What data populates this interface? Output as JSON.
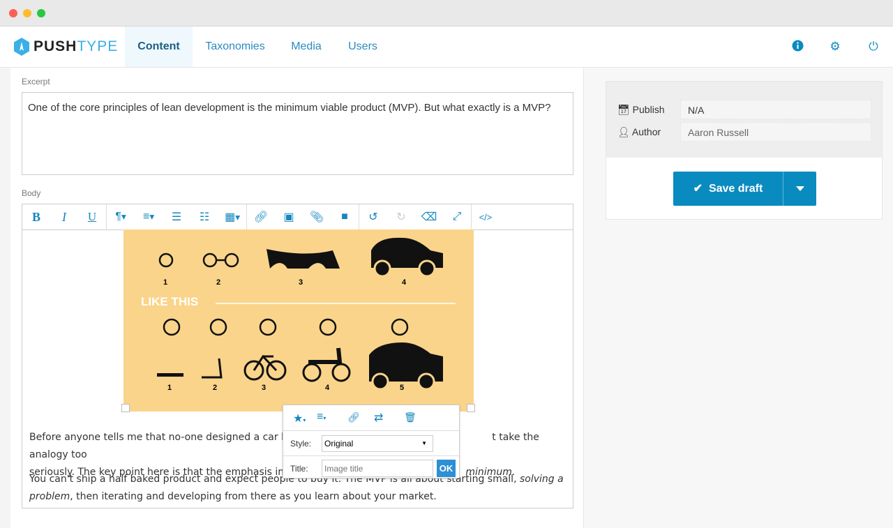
{
  "app": {
    "logo_bold": "PUSH",
    "logo_light": "TYPE"
  },
  "nav": {
    "tabs": [
      {
        "label": "Content",
        "active": true
      },
      {
        "label": "Taxonomies"
      },
      {
        "label": "Media"
      },
      {
        "label": "Users"
      }
    ],
    "icons": [
      "info-icon",
      "gear-icon",
      "power-icon"
    ]
  },
  "excerpt": {
    "label": "Excerpt",
    "value": "One of the core principles of lean development is the minimum viable product (MVP). But what exactly is a MVP?"
  },
  "body": {
    "label": "Body",
    "toolbar": [
      "bold",
      "italic",
      "underline",
      "paragraph",
      "align",
      "ordered-list",
      "unordered-list",
      "table",
      "link",
      "image",
      "file",
      "video",
      "undo",
      "redo",
      "eraser",
      "fullscreen",
      "html"
    ],
    "image": {
      "row1_numbers": [
        "1",
        "2",
        "3",
        "4"
      ],
      "caption": "LIKE THIS",
      "row2_numbers": [
        "1",
        "2",
        "3",
        "4",
        "5"
      ]
    },
    "para1_a": "Before anyone tells me that no-one designed a car by",
    "para1_b": "t take the analogy too",
    "para1_c": "seriously. The key point here is that the emphasis in r",
    "para1_d": "minimum",
    "para2_a": "You can't ship a half baked product and expect people to buy it. The MVP is all about starting small, ",
    "para2_i1": "solving a problem",
    "para2_b": ", then iterating and developing from there as you learn about your market."
  },
  "image_popup": {
    "style_label": "Style:",
    "style_value": "Original",
    "title_label": "Title:",
    "title_placeholder": "Image title",
    "ok": "OK"
  },
  "sidebar": {
    "publish_label": "Publish",
    "publish_value": "N/A",
    "author_label": "Author",
    "author_value": "Aaron Russell",
    "save_label": "Save draft"
  },
  "colors": {
    "accent": "#0a8bbf",
    "image_bg": "#f9d48a"
  }
}
